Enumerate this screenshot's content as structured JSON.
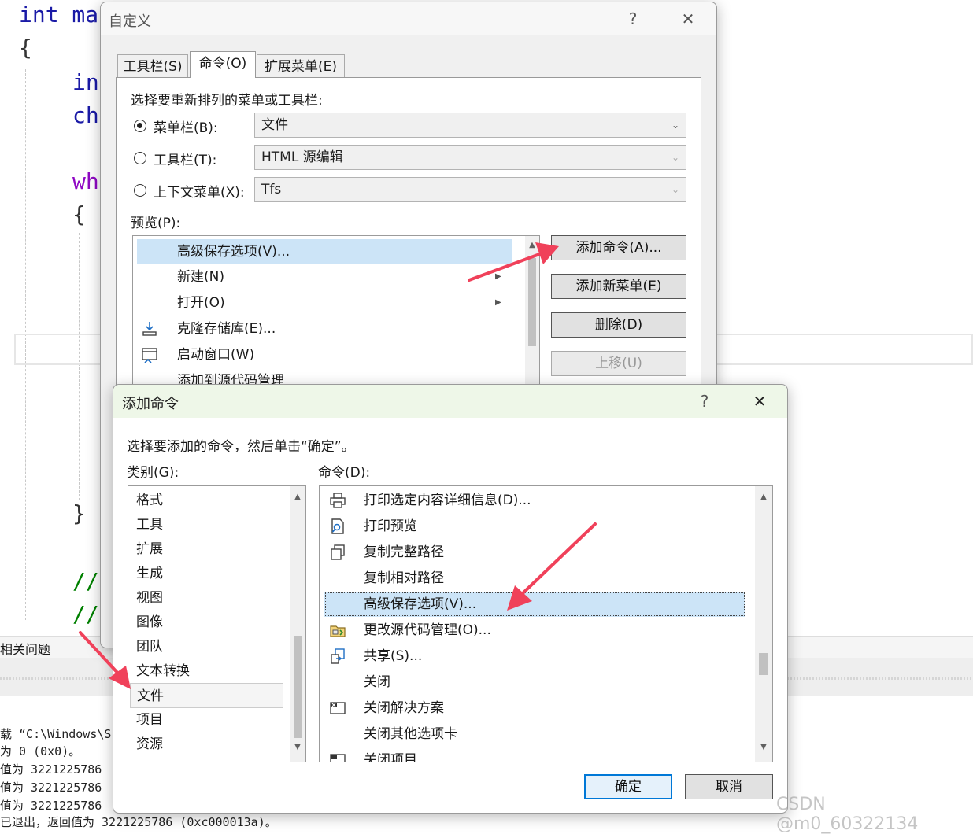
{
  "editor": {
    "lines": [
      "int ma",
      "{",
      "in",
      "ch",
      "wh",
      "{",
      "}",
      "//",
      "//"
    ],
    "tab_label": "相关问题",
    "output_lines": [
      "载 “C:\\Windows\\S",
      "为 0 (0x0)。",
      "值为 3221225786",
      "值为 3221225786",
      "值为 3221225786",
      "已退出，返回值为 3221225786 (0xc000013a)。"
    ]
  },
  "customize_dialog": {
    "title": "自定义",
    "help": "?",
    "close": "✕",
    "tabs": [
      "工具栏(S)",
      "命令(O)",
      "扩展菜单(E)"
    ],
    "prompt": "选择要重新排列的菜单或工具栏:",
    "radio_menubar": "菜单栏(B):",
    "radio_toolbar": "工具栏(T):",
    "radio_context": "上下文菜单(X):",
    "combo_menubar": "文件",
    "combo_toolbar": "HTML 源编辑",
    "combo_context": "Tfs",
    "preview_label": "预览(P):",
    "preview_items": [
      "高级保存选项(V)...",
      "新建(N)",
      "打开(O)",
      "克隆存储库(E)...",
      "启动窗口(W)",
      "添加到源代码管理"
    ],
    "btn_add_command": "添加命令(A)...",
    "btn_add_menu": "添加新菜单(E)",
    "btn_delete": "删除(D)",
    "btn_move_up": "上移(U)"
  },
  "add_command_dialog": {
    "title": "添加命令",
    "help": "?",
    "close": "✕",
    "instruction": "选择要添加的命令，然后单击“确定”。",
    "category_label": "类别(G):",
    "command_label": "命令(D):",
    "categories": [
      "格式",
      "工具",
      "扩展",
      "生成",
      "视图",
      "图像",
      "团队",
      "文本转换",
      "文件",
      "项目",
      "资源"
    ],
    "selected_category": "文件",
    "commands": [
      "打印选定内容详细信息(D)...",
      "打印预览",
      "复制完整路径",
      "复制相对路径",
      "高级保存选项(V)...",
      "更改源代码管理(O)...",
      "共享(S)...",
      "关闭",
      "关闭解决方案",
      "关闭其他选项卡",
      "关闭项目"
    ],
    "selected_command": "高级保存选项(V)...",
    "ok": "确定",
    "cancel": "取消"
  },
  "watermark": "CSDN @m0_60322134",
  "colors": {
    "arrow": "#f0415a",
    "selection": "#cce4f7",
    "primary_border": "#0078d7"
  }
}
